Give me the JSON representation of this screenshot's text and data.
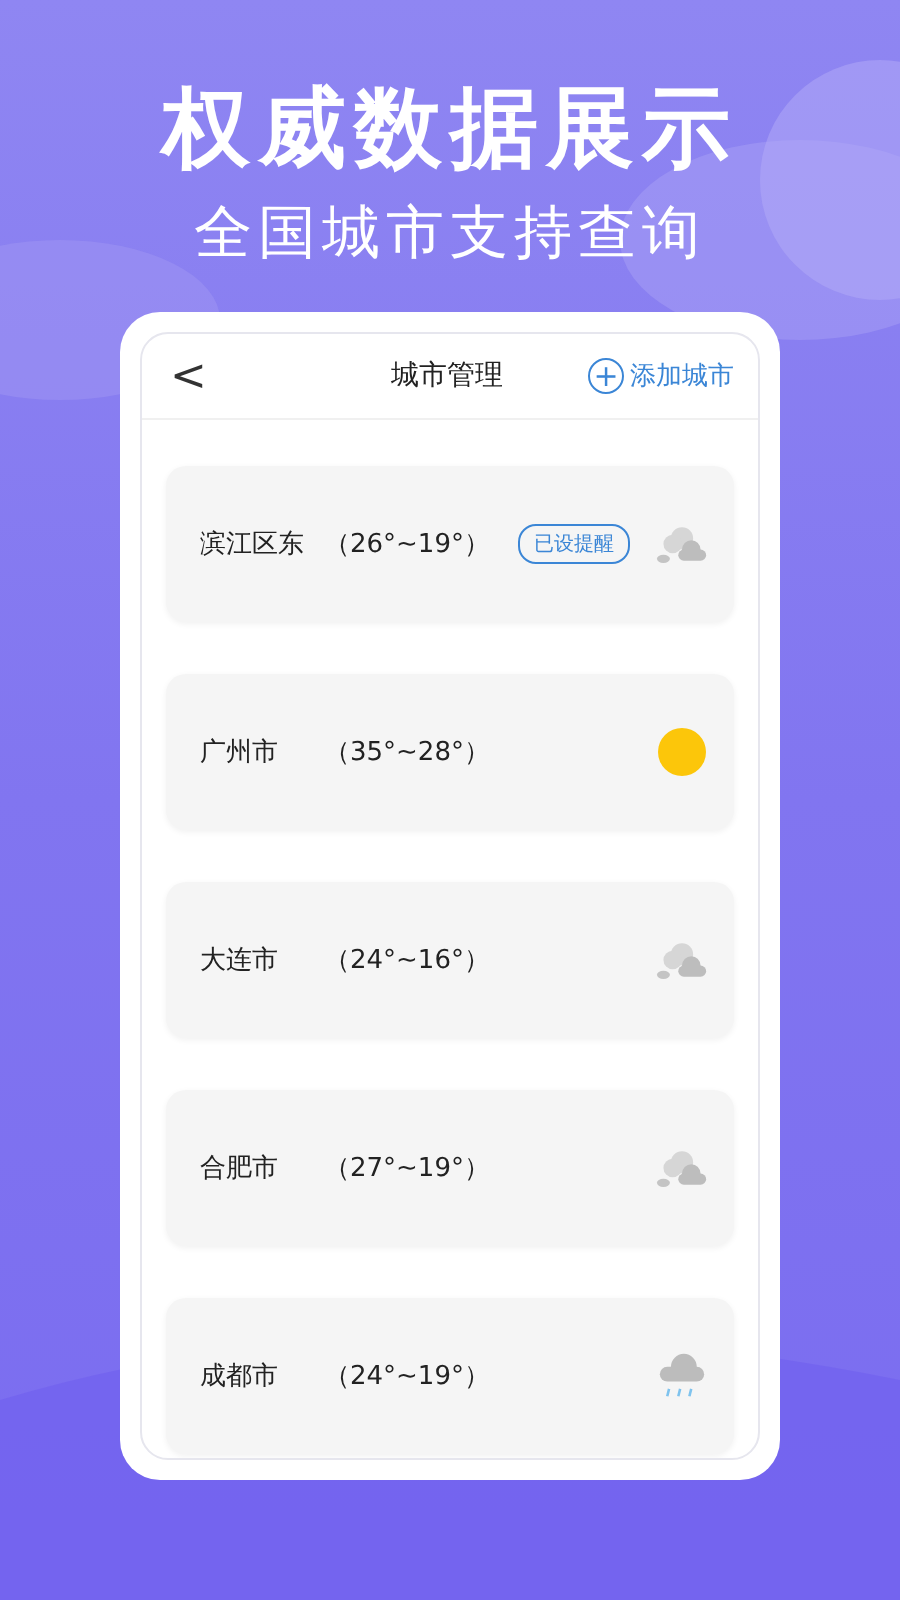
{
  "headline": "权威数据展示",
  "subheadline": "全国城市支持查询",
  "screen": {
    "back": "<",
    "title": "城市管理",
    "add_button": "添加城市",
    "add_icon": "+",
    "cities": [
      {
        "name": "滨江区东",
        "range": "（26°~19°）",
        "badge": "已设提醒",
        "kind": "cloudy"
      },
      {
        "name": "广州市",
        "range": "（35°~28°）",
        "kind": "sunny"
      },
      {
        "name": "大连市",
        "range": "（24°~16°）",
        "kind": "cloudy"
      },
      {
        "name": "合肥市",
        "range": "（27°~19°）",
        "kind": "cloudy"
      },
      {
        "name": "成都市",
        "range": "（24°~19°）",
        "kind": "rain"
      }
    ]
  }
}
